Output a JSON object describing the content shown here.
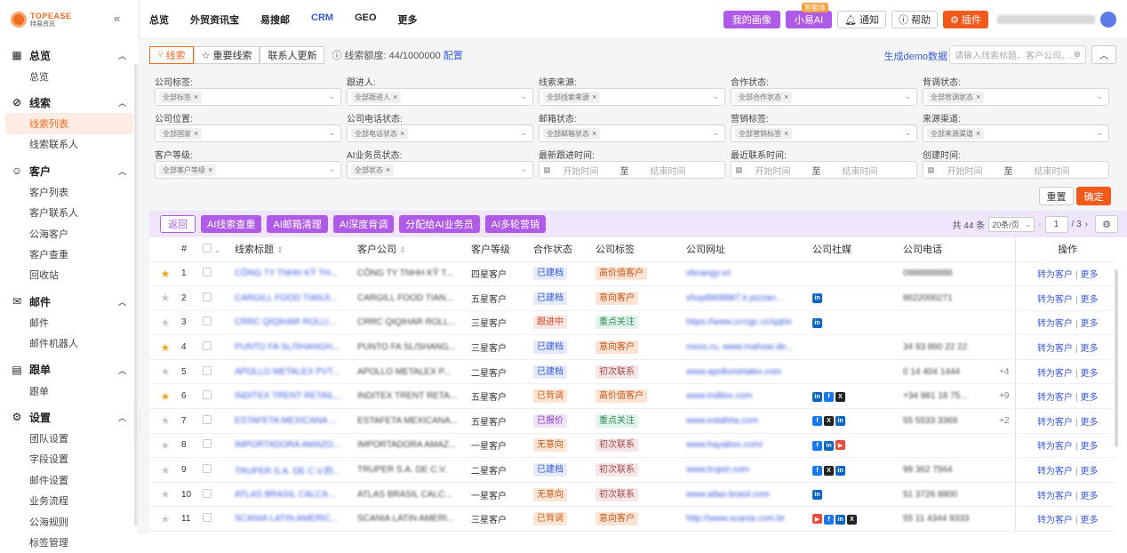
{
  "logo": {
    "brand": "TOPEASE",
    "sub": "特易资讯"
  },
  "sidebar": {
    "groups": [
      {
        "title": "总览",
        "icon": "grid-icon",
        "items": [
          {
            "label": "总览",
            "active": false
          }
        ]
      },
      {
        "title": "线索",
        "icon": "compass-icon",
        "items": [
          {
            "label": "线索列表",
            "active": true
          },
          {
            "label": "线索联系人",
            "active": false
          }
        ]
      },
      {
        "title": "客户",
        "icon": "user-icon",
        "items": [
          {
            "label": "客户列表",
            "active": false
          },
          {
            "label": "客户联系人",
            "active": false
          },
          {
            "label": "公海客户",
            "active": false
          },
          {
            "label": "客户查重",
            "active": false
          },
          {
            "label": "回收站",
            "active": false
          }
        ]
      },
      {
        "title": "邮件",
        "icon": "mail-icon",
        "items": [
          {
            "label": "邮件",
            "active": false
          },
          {
            "label": "邮件机器人",
            "active": false
          }
        ]
      },
      {
        "title": "跟单",
        "icon": "document-icon",
        "items": [
          {
            "label": "跟单",
            "active": false
          }
        ]
      },
      {
        "title": "设置",
        "icon": "gear-icon",
        "items": [
          {
            "label": "团队设置",
            "active": false
          },
          {
            "label": "字段设置",
            "active": false
          },
          {
            "label": "邮件设置",
            "active": false
          },
          {
            "label": "业务流程",
            "active": false
          },
          {
            "label": "公海规则",
            "active": false
          },
          {
            "label": "标签管理",
            "active": false
          }
        ]
      }
    ]
  },
  "topnav": {
    "items": [
      {
        "label": "总览"
      },
      {
        "label": "外贸资讯宝"
      },
      {
        "label": "易搜邮"
      },
      {
        "label": "CRM",
        "active": true
      },
      {
        "label": "GEO"
      },
      {
        "label": "更多"
      }
    ],
    "my_portrait": "我的画像",
    "xiaoyi": "小易AI",
    "xiaoyi_badge": "智能体",
    "notify": "通知",
    "help": "帮助",
    "plugin": "插件"
  },
  "toolbar": {
    "tabs": [
      {
        "label": "线索",
        "active": true
      },
      {
        "label": "重要线索"
      },
      {
        "label": "联系人更新"
      }
    ],
    "quota_label": "线索额度: 44/1000000",
    "quota_link": "配置",
    "demo_link": "生成demo数据",
    "search_placeholder": "请输入线索标题、客户公司、..."
  },
  "filters": [
    {
      "label": "公司标签:",
      "chip": "全部标签"
    },
    {
      "label": "跟进人:",
      "chip": "全部跟进人"
    },
    {
      "label": "线索来源:",
      "chip": "全部线索来源"
    },
    {
      "label": "合作状态:",
      "chip": "全部合作状态"
    },
    {
      "label": "背调状态:",
      "chip": "全部背调状态"
    },
    {
      "label": "公司位置:",
      "chip": "全部国家"
    },
    {
      "label": "公司电话状态:",
      "chip": "全部电话状态"
    },
    {
      "label": "邮箱状态:",
      "chip": "全部邮箱状态"
    },
    {
      "label": "营销标签:",
      "chip": "全部营销标签"
    },
    {
      "label": "来源渠道:",
      "chip": "全部来源渠道"
    },
    {
      "label": "客户等级:",
      "chip": "全部客户等级"
    },
    {
      "label": "AI业务员状态:",
      "chip": "全部状态"
    }
  ],
  "date_filters": [
    {
      "label": "最新跟进时间:",
      "start": "开始时间",
      "to": "至",
      "end": "结束时间"
    },
    {
      "label": "最近联系时间:",
      "start": "开始时间",
      "to": "至",
      "end": "结束时间"
    },
    {
      "label": "创建时间:",
      "start": "开始时间",
      "to": "至",
      "end": "结束时间"
    }
  ],
  "filter_buttons": {
    "reset": "重置",
    "ok": "确定"
  },
  "actions": {
    "back": "返回",
    "ai_buttons": [
      "AI线索查重",
      "AI邮箱清理",
      "AI深度背调",
      "分配给AI业务员",
      "AI多轮营销"
    ]
  },
  "pager": {
    "total": "共 44 条",
    "page_size": "20条/页",
    "current": "1",
    "total_pages": "/ 3"
  },
  "table": {
    "headers": [
      "#",
      "线索标题",
      "客户公司",
      "客户等级",
      "合作状态",
      "公司标签",
      "公司网址",
      "公司社媒",
      "公司电话",
      "操作"
    ],
    "rows": [
      {
        "n": "1",
        "star": true,
        "title": "CÔNG TY TNHH KỸ TH...",
        "company": "CÔNG TY TNHH KỸ T...",
        "level": "四星客户",
        "status": "已建档",
        "tag": "高价值客户",
        "url": "vbnangy.vn",
        "social": [],
        "phone": "0988888888",
        "more": "",
        "op1": "转为客户",
        "op2": "更多"
      },
      {
        "n": "2",
        "star": false,
        "title": "CARGILL FOOD TIANJI...",
        "company": "CARGILL FOOD TIAN...",
        "level": "五星客户",
        "status": "已建档",
        "tag": "意向客户",
        "url": "shop8808887.tr.pizzan...",
        "social": [
          "li"
        ],
        "phone": "8622000271",
        "more": "",
        "op1": "转为客户",
        "op2": "更多"
      },
      {
        "n": "3",
        "star": false,
        "title": "CRRC QIQIHAR ROLLI...",
        "company": "CRRC QIQIHAR ROLL...",
        "level": "三星客户",
        "status": "跟进中",
        "tag": "重点关注",
        "url": "https://www.crrcgc.cc/qqhe",
        "social": [
          "li"
        ],
        "phone": "",
        "more": "",
        "op1": "转为客户",
        "op2": "更多"
      },
      {
        "n": "4",
        "star": true,
        "title": "PUNTO FA SL/SHANGH...",
        "company": "PUNTO FA SL/SHANG...",
        "level": "三星客户",
        "status": "已建档",
        "tag": "意向客户",
        "url": "mexs.ru, www.mahoar.de...",
        "social": [],
        "phone": "34 93 860 22 22",
        "more": "",
        "op1": "转为客户",
        "op2": "更多"
      },
      {
        "n": "5",
        "star": false,
        "title": "APOLLO METALEX PVT...",
        "company": "APOLLO METALEX P...",
        "level": "二星客户",
        "status": "已建档",
        "tag": "初次联系",
        "url": "www.apollometalex.com",
        "social": [],
        "phone": "0 14 404 1444",
        "more": "+4",
        "op1": "转为客户",
        "op2": "更多"
      },
      {
        "n": "6",
        "star": true,
        "title": "INDITEX TRENT RETAIL...",
        "company": "INDITEX TRENT RETA...",
        "level": "五星客户",
        "status": "已背调",
        "tag": "高价值客户",
        "url": "www.inditex.com",
        "social": [
          "li",
          "fb",
          "xx"
        ],
        "phone": "+34 981 18 75...",
        "more": "+9",
        "op1": "转为客户",
        "op2": "更多"
      },
      {
        "n": "7",
        "star": false,
        "title": "ESTAFETA MEXICANA ...",
        "company": "ESTAFETA MEXICANA...",
        "level": "五星客户",
        "status": "已报价",
        "tag": "重点关注",
        "url": "www.estafeta.com",
        "social": [
          "fb",
          "xx",
          "li"
        ],
        "phone": "55 5533 3369",
        "more": "+2",
        "op1": "转为客户",
        "op2": "更多"
      },
      {
        "n": "8",
        "star": false,
        "title": "IMPORTADORA AMAZO...",
        "company": "IMPORTADORA AMAZ...",
        "level": "一星客户",
        "status": "无意向",
        "tag": "初次联系",
        "url": "www.hayabox.com/",
        "social": [
          "fb",
          "li",
          "yt"
        ],
        "phone": "",
        "more": "",
        "op1": "转为客户",
        "op2": "更多"
      },
      {
        "n": "9",
        "star": false,
        "title": "TRUPER S.A. DE C.V.的...",
        "company": "TRUPER S.A. DE C.V.",
        "level": "二星客户",
        "status": "已建档",
        "tag": "初次联系",
        "url": "www.truper.com",
        "social": [
          "fb",
          "xx",
          "li"
        ],
        "phone": "99 362 7564",
        "more": "",
        "op1": "转为客户",
        "op2": "更多"
      },
      {
        "n": "10",
        "star": false,
        "title": "ATLAS BRASIL CALCA...",
        "company": "ATLAS BRASIL CALC...",
        "level": "一星客户",
        "status": "无意向",
        "tag": "初次联系",
        "url": "www.atlas-brasil.com",
        "social": [
          "li"
        ],
        "phone": "51 3726 8800",
        "more": "",
        "op1": "转为客户",
        "op2": "更多"
      },
      {
        "n": "11",
        "star": false,
        "title": "SCANIA LATIN AMERIC...",
        "company": "SCANIA LATIN AMERI...",
        "level": "三星客户",
        "status": "已背调",
        "tag": "意向客户",
        "url": "http://www.scania.com.br",
        "social": [
          "yt",
          "fb",
          "li",
          "xx"
        ],
        "phone": "55 11 4344 9333",
        "more": "",
        "op1": "转为客户",
        "op2": "更多"
      }
    ]
  },
  "colors": {
    "accent": "#f26b22",
    "purple": "#b05be8",
    "link": "#3b5bdb",
    "status": {
      "已建档": [
        "#e5ebfb",
        "#3b5bdb"
      ],
      "跟进中": [
        "#fde4e1",
        "#d0482b"
      ],
      "已背调": [
        "#fde6d6",
        "#d06018"
      ],
      "已报价": [
        "#efe2fb",
        "#8a3fd1"
      ],
      "无意向": [
        "#fde6d6",
        "#c2571a"
      ]
    },
    "tags": {
      "高价值客户": [
        "#fde3d4",
        "#c2571a"
      ],
      "意向客户": [
        "#fde3d4",
        "#c2571a"
      ],
      "重点关注": [
        "#e1f5ea",
        "#2e8b57"
      ],
      "初次联系": [
        "#f6e6e6",
        "#a64b4b"
      ]
    }
  }
}
